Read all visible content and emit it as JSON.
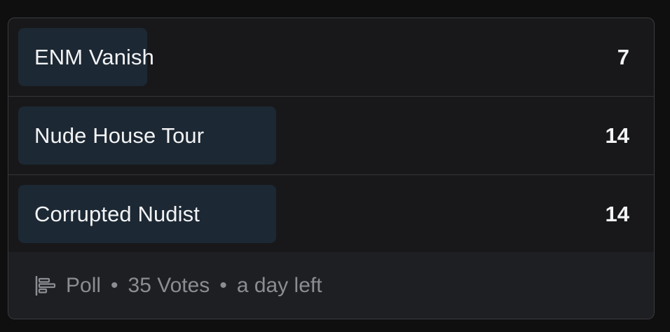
{
  "poll": {
    "options": [
      {
        "label": "ENM Vanish",
        "votes": "7",
        "fraction": 0.2
      },
      {
        "label": "Nude House Tour",
        "votes": "14",
        "fraction": 0.4
      },
      {
        "label": "Corrupted Nudist",
        "votes": "14",
        "fraction": 0.4
      }
    ],
    "footer": {
      "type_label": "Poll",
      "votes_label": "35 Votes",
      "time_left": "a day left",
      "icon": "poll-chart-icon"
    }
  },
  "colors": {
    "background": "#0f0f10",
    "card": "#18181a",
    "bar": "#1c2833",
    "footer": "#1e1f22",
    "text": "#f2f3f5",
    "muted": "#8b8d93"
  }
}
